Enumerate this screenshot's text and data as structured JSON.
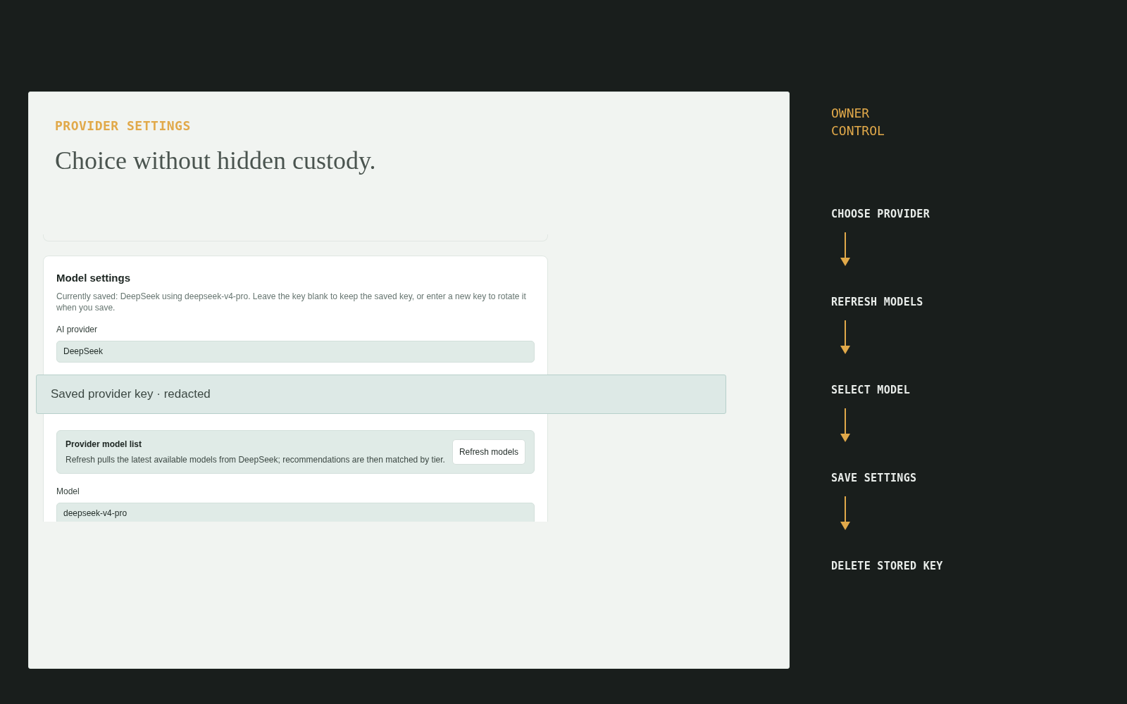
{
  "header": {
    "eyebrow": "PROVIDER SETTINGS",
    "title": "Choice without hidden custody."
  },
  "card": {
    "title": "Model settings",
    "description": "Currently saved: DeepSeek using deepseek-v4-pro. Leave the key blank to keep the saved key, or enter a new key to rotate it when you save.",
    "provider_field": {
      "label": "AI provider",
      "value": "DeepSeek"
    },
    "model_list": {
      "title": "Provider model list",
      "description": "Refresh pulls the latest available models from DeepSeek; recommendations are then matched by tier.",
      "button": "Refresh models"
    },
    "model_field": {
      "label": "Model",
      "value": "deepseek-v4-pro"
    }
  },
  "overlay": {
    "text": "Saved provider key · redacted"
  },
  "sidebar": {
    "title": "OWNER CONTROL",
    "steps": [
      "CHOOSE PROVIDER",
      "REFRESH MODELS",
      "SELECT MODEL",
      "SAVE SETTINGS",
      "DELETE STORED KEY"
    ]
  }
}
